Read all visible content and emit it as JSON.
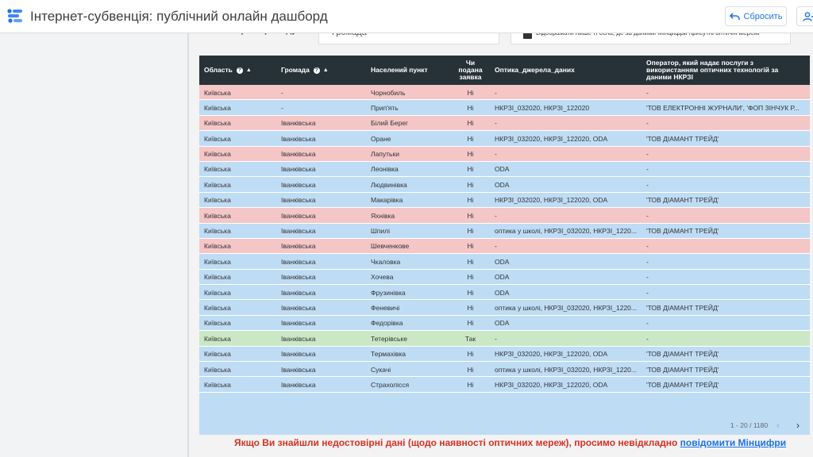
{
  "header": {
    "title": "Інтернет-субвенція: публічний онлайн дашборд",
    "reset_label": "Сбросить"
  },
  "filters": {
    "gromada_label": "Оберіть громаду:",
    "gromada_placeholder": "Громада",
    "checkbox_text": "Відображати лише ті села, де за даними Мінцифри присутні оптичні мережі"
  },
  "table": {
    "columns": [
      "Область",
      "Громада",
      "Населений пункт",
      "Чи подана заявка",
      "Оптика_джерела_даних",
      "Оператор, який надає послуги з використанням оптичних технологій за даними НКРЗІ"
    ],
    "rows": [
      {
        "status": "no",
        "oblast": "Київська",
        "gromada": "-",
        "settlement": "Чорнобиль",
        "applied": "Ні",
        "optics": "-",
        "operator": "-"
      },
      {
        "status": "opt",
        "oblast": "Київська",
        "gromada": "-",
        "settlement": "Прип'ять",
        "applied": "Ні",
        "optics": "НКРЗІ_032020, НКРЗІ_122020",
        "operator": "'ТОВ ЕЛЕКТРОННІ ЖУРНАЛИ', 'ФОП ЗІНЧУК Р..."
      },
      {
        "status": "no",
        "oblast": "Київська",
        "gromada": "Іванківська",
        "settlement": "Білий Берег",
        "applied": "Ні",
        "optics": "-",
        "operator": "-"
      },
      {
        "status": "opt",
        "oblast": "Київська",
        "gromada": "Іванківська",
        "settlement": "Оране",
        "applied": "Ні",
        "optics": "НКРЗІ_032020, НКРЗІ_122020, ODA",
        "operator": "'ТОВ ДІАМАНТ ТРЕЙД'"
      },
      {
        "status": "no",
        "oblast": "Київська",
        "gromada": "Іванківська",
        "settlement": "Лапутьки",
        "applied": "Ні",
        "optics": "-",
        "operator": "-"
      },
      {
        "status": "opt",
        "oblast": "Київська",
        "gromada": "Іванківська",
        "settlement": "Леонівка",
        "applied": "Ні",
        "optics": "ODA",
        "operator": "-"
      },
      {
        "status": "opt",
        "oblast": "Київська",
        "gromada": "Іванківська",
        "settlement": "Людвинівка",
        "applied": "Ні",
        "optics": "ODA",
        "operator": "-"
      },
      {
        "status": "opt",
        "oblast": "Київська",
        "gromada": "Іванківська",
        "settlement": "Макарівка",
        "applied": "Ні",
        "optics": "НКРЗІ_032020, НКРЗІ_122020, ODA",
        "operator": "'ТОВ ДІАМАНТ ТРЕЙД'"
      },
      {
        "status": "no",
        "oblast": "Київська",
        "gromada": "Іванківська",
        "settlement": "Яхнівка",
        "applied": "Ні",
        "optics": "-",
        "operator": "-"
      },
      {
        "status": "opt",
        "oblast": "Київська",
        "gromada": "Іванківська",
        "settlement": "Шпилі",
        "applied": "Ні",
        "optics": "оптика у школі, НКРЗІ_032020, НКРЗІ_1220...",
        "operator": "'ТОВ ДІАМАНТ ТРЕЙД'"
      },
      {
        "status": "no",
        "oblast": "Київська",
        "gromada": "Іванківська",
        "settlement": "Шевченкове",
        "applied": "Ні",
        "optics": "-",
        "operator": "-"
      },
      {
        "status": "opt",
        "oblast": "Київська",
        "gromada": "Іванківська",
        "settlement": "Чкаловка",
        "applied": "Ні",
        "optics": "ODA",
        "operator": "-"
      },
      {
        "status": "opt",
        "oblast": "Київська",
        "gromada": "Іванківська",
        "settlement": "Хочева",
        "applied": "Ні",
        "optics": "ODA",
        "operator": "-"
      },
      {
        "status": "opt",
        "oblast": "Київська",
        "gromada": "Іванківська",
        "settlement": "Фрузинівка",
        "applied": "Ні",
        "optics": "ODA",
        "operator": "-"
      },
      {
        "status": "opt",
        "oblast": "Київська",
        "gromada": "Іванківська",
        "settlement": "Феневичі",
        "applied": "Ні",
        "optics": "оптика у школі, НКРЗІ_032020, НКРЗІ_1220...",
        "operator": "'ТОВ ДІАМАНТ ТРЕЙД'"
      },
      {
        "status": "opt",
        "oblast": "Київська",
        "gromada": "Іванківська",
        "settlement": "Федорівка",
        "applied": "Ні",
        "optics": "ODA",
        "operator": "-"
      },
      {
        "status": "yes",
        "oblast": "Київська",
        "gromada": "Іванківська",
        "settlement": "Тетерівське",
        "applied": "Так",
        "optics": "-",
        "operator": "-"
      },
      {
        "status": "opt",
        "oblast": "Київська",
        "gromada": "Іванківська",
        "settlement": "Термахівка",
        "applied": "Ні",
        "optics": "НКРЗІ_032020, НКРЗІ_122020, ODA",
        "operator": "'ТОВ ДІАМАНТ ТРЕЙД'"
      },
      {
        "status": "opt",
        "oblast": "Київська",
        "gromada": "Іванківська",
        "settlement": "Сукачі",
        "applied": "Ні",
        "optics": "оптика у школі, НКРЗІ_032020, НКРЗІ_1220...",
        "operator": "'ТОВ ДІАМАНТ ТРЕЙД'"
      },
      {
        "status": "opt",
        "oblast": "Київська",
        "gromada": "Іванківська",
        "settlement": "Страхолісся",
        "applied": "Ні",
        "optics": "НКРЗІ_032020, НКРЗІ_122020, ODA",
        "operator": "'ТОВ ДІАМАНТ ТРЕЙД'"
      }
    ],
    "pagination": "1 - 20 / 1180"
  },
  "notice": {
    "text": "Якщо Ви знайшли недостовірні дані (щодо наявності оптичних мереж), просимо невідкладно ",
    "link": "повідомити Мінцифри"
  },
  "colors": {
    "header_bg": "#263238",
    "row_no": "#f5c6c6",
    "row_optics": "#bfdcf5",
    "row_yes": "#cbe8c6",
    "notice_red": "#d93025",
    "link_blue": "#1a73e8"
  }
}
